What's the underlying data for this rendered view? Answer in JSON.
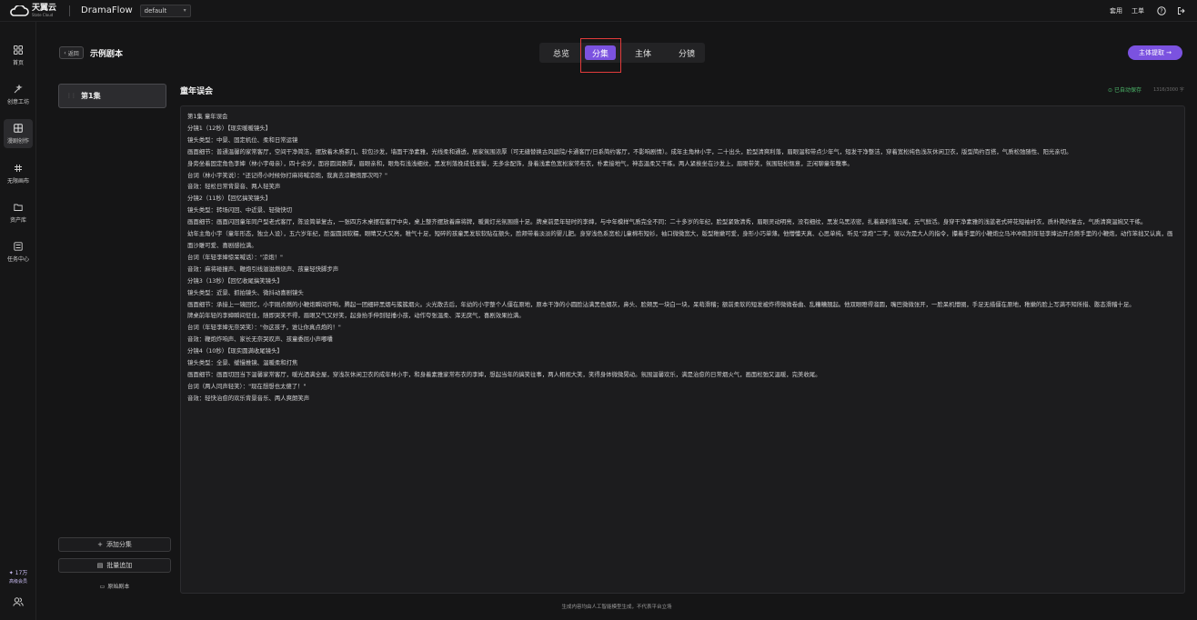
{
  "topbar": {
    "logo_cn": "天翼云",
    "logo_en": "State Cloud",
    "app_name": "DramaFlow",
    "project": "default",
    "links": [
      "套用",
      "工单"
    ],
    "help_icon": "help-icon",
    "exit_icon": "logout-icon"
  },
  "sidebar": {
    "items": [
      {
        "icon": "grid-icon",
        "label": "首页"
      },
      {
        "icon": "magic-wand-icon",
        "label": "创意工坊"
      },
      {
        "icon": "storyboard-icon",
        "label": "漫剧创作"
      },
      {
        "icon": "hash-icon",
        "label": "无限画布"
      },
      {
        "icon": "folder-icon",
        "label": "资产库"
      },
      {
        "icon": "task-icon",
        "label": "任务中心"
      }
    ],
    "member_value": "17万",
    "member_label": "高级会员"
  },
  "header": {
    "back_label": "返回",
    "title": "示例剧本",
    "tabs": [
      "总览",
      "分集",
      "主体",
      "分镜"
    ],
    "active_tab": "分集",
    "extract_label": "主体提取 →"
  },
  "episodes": {
    "items": [
      {
        "label": "第1集"
      }
    ],
    "add_label": "添加分集",
    "batch_label": "批量追加",
    "raw_label": "原始剧本"
  },
  "editor": {
    "title": "童年误会",
    "saved": "已自动保存",
    "counter": "1316/3000 字",
    "lines": [
      "第1集 童年误会",
      "分镜1（12秒）【现实暖暖镜头】",
      "镜头类型：中景、固定机位、柔和日常运镜",
      "画面细节：普通温馨的家常客厅，空间干净简洁，摆放着木质茶几、软包沙发，墙面干净素雅，光线柔和通透，居家氛围浓厚（可无缝替换古风庭院/卡通客厅/日系简约客厅，不影响剧情）。成年主角林小宇，二十出头，脸型清爽利落，眉眼温和带点少年气，短发干净整洁，穿着宽松纯色浅灰休闲卫衣，版型简约百搭，气质松弛随性、阳光亲切。",
      "身旁坐着固定角色李婶（林小宇母亲），四十余岁，面容圆润数厚，眉眼亲和，眼角有浅浅细纹，黑发利落挽成低发髻，无多余配饰，身着浅素色宽松家常布衣，朴素接地气，神态温柔又干练。两人紧挨坐在沙发上，眉眼带笑，氛围轻松惬意，正闲聊童年糗事。",
      "台词（林小宇笑说）：\"还记得小时候你打麻将喊凉炮，我真去凉鞭炮那次吗？\"",
      "音效：轻松日常背景音、两人轻笑声",
      "分镜2（11秒）【回忆搞笑镜头】",
      "镜头类型：转场闪回、中近景、轻微快切",
      "画面细节：画面闪回童年同户型老式客厅，陈设简单复古，一张四方木桌摆在客厅中央，桌上整齐摆放着麻将牌，暖黄灯光氛围感十足。牌桌前是年轻时的李婶，与中年模样气质完全不同：二十多岁的年纪，脸型紧致清秀，眉眼灵动明亮，没有细纹，黑发乌黑浓密，扎着高利落马尾，元气鲜活。身穿干净素雅的浅蓝老式碎花短袖衬衣，质朴简约复古，气质清爽温婉又干练。",
      "幼年主角小宇（童年形态，独立人设），五六岁年纪，脸蛋圆润软糯，眼睛又大又亮，稚气十足，短碎的孩童黑发软软贴在额头，脸颊带着淡淡的婴儿肥。身穿浅色系宽松儿童棉布短衫，袖口微微宽大，版型稚嫩可爱，身形小巧单薄。他懵懂天真、心思单纯，听见“凉炮”二字，误以为是大人的指令，攥着手里的小鞭炮立马冲冲跑到年轻李婶边开点燃手里的小鞭炮，动作笨拙又认真，画面沙雕可爱、喜剧感拉满。",
      "台词（年轻李婶惊呆喊话）：\"凉炮！\"",
      "音效：麻将碰撞声、鞭炮引线滋滋燃烧声、孩童轻快脚步声",
      "分镜3（13秒）【回忆收尾搞笑镜头】",
      "镜头类型：近景、抓拍镜头、微抖动喜剧镜头",
      "画面细节：承接上一镜回忆，小宇刚点燃的小鞭炮瞬间炸响，腾起一团细碎黑烟与簇簇烟火。火光散去后，年幼的小宇整个人僵在原地，原本干净的小圆脸沾满黑色烟灰，鼻头、脸颊黑一块白一块，呆萌滑稽；额前柔软的短发被炸得微微卷曲、乱糟糟翘起。他双眼瞪得溜圆，嘴巴微微张开，一脸呆机懵圈，手足无措僵在原地，稚嫩的脸上写满不知所措、憨态滑稽十足。",
      "牌桌前年轻的李婶瞬间怔住，随即哭笑不得，眉眼又气又好笑，起身抬手伸到轻捶小孩，动作夸张温柔、浑无戾气，喜剧效果拉满。",
      "台词（年轻李婶无奈哭笑）：\"你这孩子，谁让你真点炮的！\"",
      "音效：鞭炮炸响声、家长无奈哭叹声、孩童委屈小声嘟囔",
      "分镜4（10秒）【现实圆满收尾镜头】",
      "镜头类型：全景、缓慢推镜、温暖柔和打焦",
      "画面细节：画面切回当下温馨家常客厅，暖光洒满全屋，穿浅灰休闲卫衣的成年林小宇，和身着素雅家常布衣的李婶，想起当年的搞笑往事，两人相视大笑，笑得身体微微晃动。氛围温馨欢乐，满是治愈的日常烟火气，画面松弛又温暖，完美收尾。",
      "台词（两人同声轻笑）：\"现在想想也太傻了！\"",
      "音效：轻快治愈的欢乐背景音乐、两人爽朗笑声"
    ]
  },
  "footer": {
    "note": "生成内容均由人工智能模型生成，不代表平台立场"
  },
  "colors": {
    "accent": "#7b52e0",
    "saved": "#4cb86a",
    "highlight": "#e23b3b"
  }
}
